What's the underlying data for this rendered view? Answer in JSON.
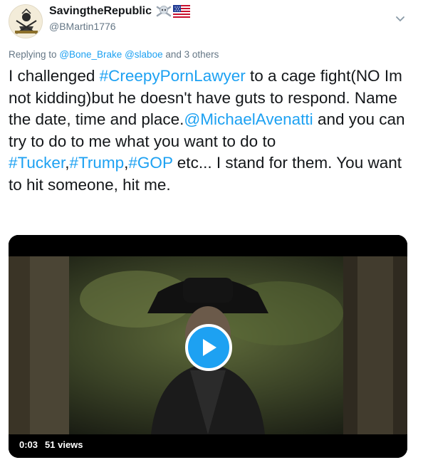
{
  "author": {
    "display_name": "SavingtheRepublic",
    "handle": "@BMartin1776",
    "name_emojis": [
      "skull-crossbones-icon",
      "us-flag-icon"
    ]
  },
  "reply_context": {
    "prefix": "Replying to",
    "users": [
      "@Bone_Brake",
      "@slaboe"
    ],
    "suffix": "and 3 others"
  },
  "tweet": {
    "segments": [
      {
        "text": "I challenged ",
        "type": "text"
      },
      {
        "text": "#CreepyPornLawyer",
        "type": "hashtag"
      },
      {
        "text": " to a cage fight(NO Im not kidding)but he doesn't have guts to respond. Name the date, time and place.",
        "type": "text"
      },
      {
        "text": "@MichaelAvenatti",
        "type": "mention"
      },
      {
        "text": " and you can try to do to me what you want to do to ",
        "type": "text"
      },
      {
        "text": "#Tucker",
        "type": "hashtag"
      },
      {
        "text": ",",
        "type": "text"
      },
      {
        "text": "#Trump",
        "type": "hashtag"
      },
      {
        "text": ",",
        "type": "text"
      },
      {
        "text": "#GOP",
        "type": "hashtag"
      },
      {
        "text": " etc... I stand for them. You want to hit someone, hit me.",
        "type": "text"
      }
    ]
  },
  "video": {
    "duration": "0:03",
    "views": "51 views"
  },
  "colors": {
    "link": "#1da1f2",
    "text": "#14171a",
    "secondary": "#657786"
  }
}
